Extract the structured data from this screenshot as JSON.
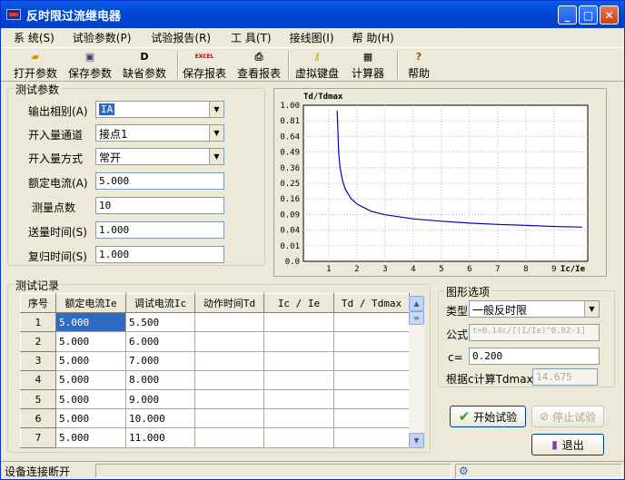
{
  "window": {
    "title": "反时限过流继电器"
  },
  "menu": [
    "系 统(S)",
    "试验参数(P)",
    "试验报告(R)",
    "工 具(T)",
    "接线图(I)",
    "帮 助(H)"
  ],
  "toolbar": [
    "打开参数",
    "保存参数",
    "缺省参数",
    "保存报表",
    "查看报表",
    "虚拟键盘",
    "计算器",
    "帮助"
  ],
  "toolbar_icon_text": {
    "excel": "EXCEL",
    "default": "D",
    "help": "?"
  },
  "test_params": {
    "group": "测试参数",
    "output_phase": {
      "label": "输出相别(A)",
      "value": "IA"
    },
    "input_channel": {
      "label": "开入量通道",
      "value": "接点1"
    },
    "input_mode": {
      "label": "开入量方式",
      "value": "常开"
    },
    "rated_current": {
      "label": "额定电流(A)",
      "value": "5.000"
    },
    "points": {
      "label": "测量点数",
      "value": "10"
    },
    "send_time": {
      "label": "送量时间(S)",
      "value": "1.000"
    },
    "reset_time": {
      "label": "复归时间(S)",
      "value": "1.000"
    }
  },
  "chart_data": {
    "type": "line",
    "ylabel": "Td/Tdmax",
    "xlabel": "Ic/Ie",
    "x_ticks": [
      "1",
      "2",
      "3",
      "4",
      "5",
      "6",
      "7",
      "8",
      "9"
    ],
    "y_ticks": [
      "1.00",
      "0.81",
      "0.64",
      "0.49",
      "0.36",
      "0.25",
      "0.16",
      "0.09",
      "0.04",
      "0.01",
      "0.0"
    ],
    "y_scale": "sqrt",
    "xlim": [
      0.1,
      10.2
    ],
    "ylim": [
      0,
      1
    ],
    "grid": true,
    "series": [
      {
        "color": "#0000c0",
        "x": [
          1.3,
          1.35,
          1.4,
          1.5,
          1.6,
          1.8,
          2.0,
          2.5,
          3,
          4,
          5,
          6,
          7,
          8,
          9,
          10
        ],
        "y": [
          0.93,
          0.5,
          0.36,
          0.26,
          0.21,
          0.16,
          0.135,
          0.103,
          0.089,
          0.074,
          0.066,
          0.06,
          0.056,
          0.053,
          0.05,
          0.048
        ]
      }
    ]
  },
  "records": {
    "group": "测试记录",
    "columns": [
      "序号",
      "额定电流Ie",
      "调试电流Ic",
      "动作时间Td",
      "Ic / Ie",
      "Td / Tdmax"
    ],
    "rows": [
      [
        "1",
        "5.000",
        "5.500",
        "",
        "",
        ""
      ],
      [
        "2",
        "5.000",
        "6.000",
        "",
        "",
        ""
      ],
      [
        "3",
        "5.000",
        "7.000",
        "",
        "",
        ""
      ],
      [
        "4",
        "5.000",
        "8.000",
        "",
        "",
        ""
      ],
      [
        "5",
        "5.000",
        "9.000",
        "",
        "",
        ""
      ],
      [
        "6",
        "5.000",
        "10.000",
        "",
        "",
        ""
      ],
      [
        "7",
        "5.000",
        "11.000",
        "",
        "",
        ""
      ]
    ]
  },
  "graph_opts": {
    "group": "图形选项",
    "type_label": "类型",
    "type_value": "一般反时限",
    "formula_label": "公式",
    "formula_value": "t=0.14c/[(I/Ie)^0.02-1]",
    "c_label": "c=",
    "c_value": "0.200",
    "tdmax_label": "根据c计算Tdmax=",
    "tdmax_value": "14.675"
  },
  "buttons": {
    "start": "开始试验",
    "stop": "停止试验",
    "exit": "退出"
  },
  "status": {
    "text": "设备连接断开"
  },
  "colors": {
    "accent": "#316ac5",
    "title": "#0046d5"
  }
}
